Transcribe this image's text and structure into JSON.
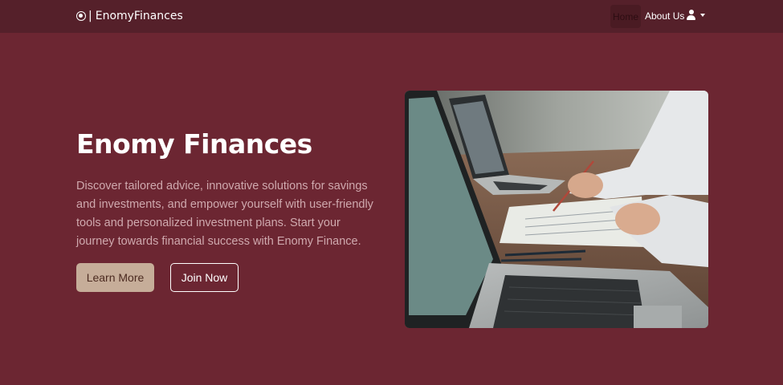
{
  "navbar": {
    "brand_separator": "|",
    "brand_name": "EnomyFinances",
    "links": {
      "home": "Home",
      "about": "About Us"
    },
    "user_menu_icon": "user-icon",
    "caret_icon": "caret-down-icon"
  },
  "hero": {
    "title": "Enomy Finances",
    "description": "Discover tailored advice, innovative solutions for savings and investments, and empower yourself with user-friendly tools and personalized investment plans. Start your journey towards financial success with Enomy Finance.",
    "learn_more_label": "Learn More",
    "join_now_label": "Join Now",
    "image_subject": "laptops-and-notes-photo"
  },
  "colors": {
    "page_background": "#6c2632",
    "navbar_background": "#55202a",
    "primary_button": "#c6ad99",
    "description_text": "#cfa9ae"
  }
}
